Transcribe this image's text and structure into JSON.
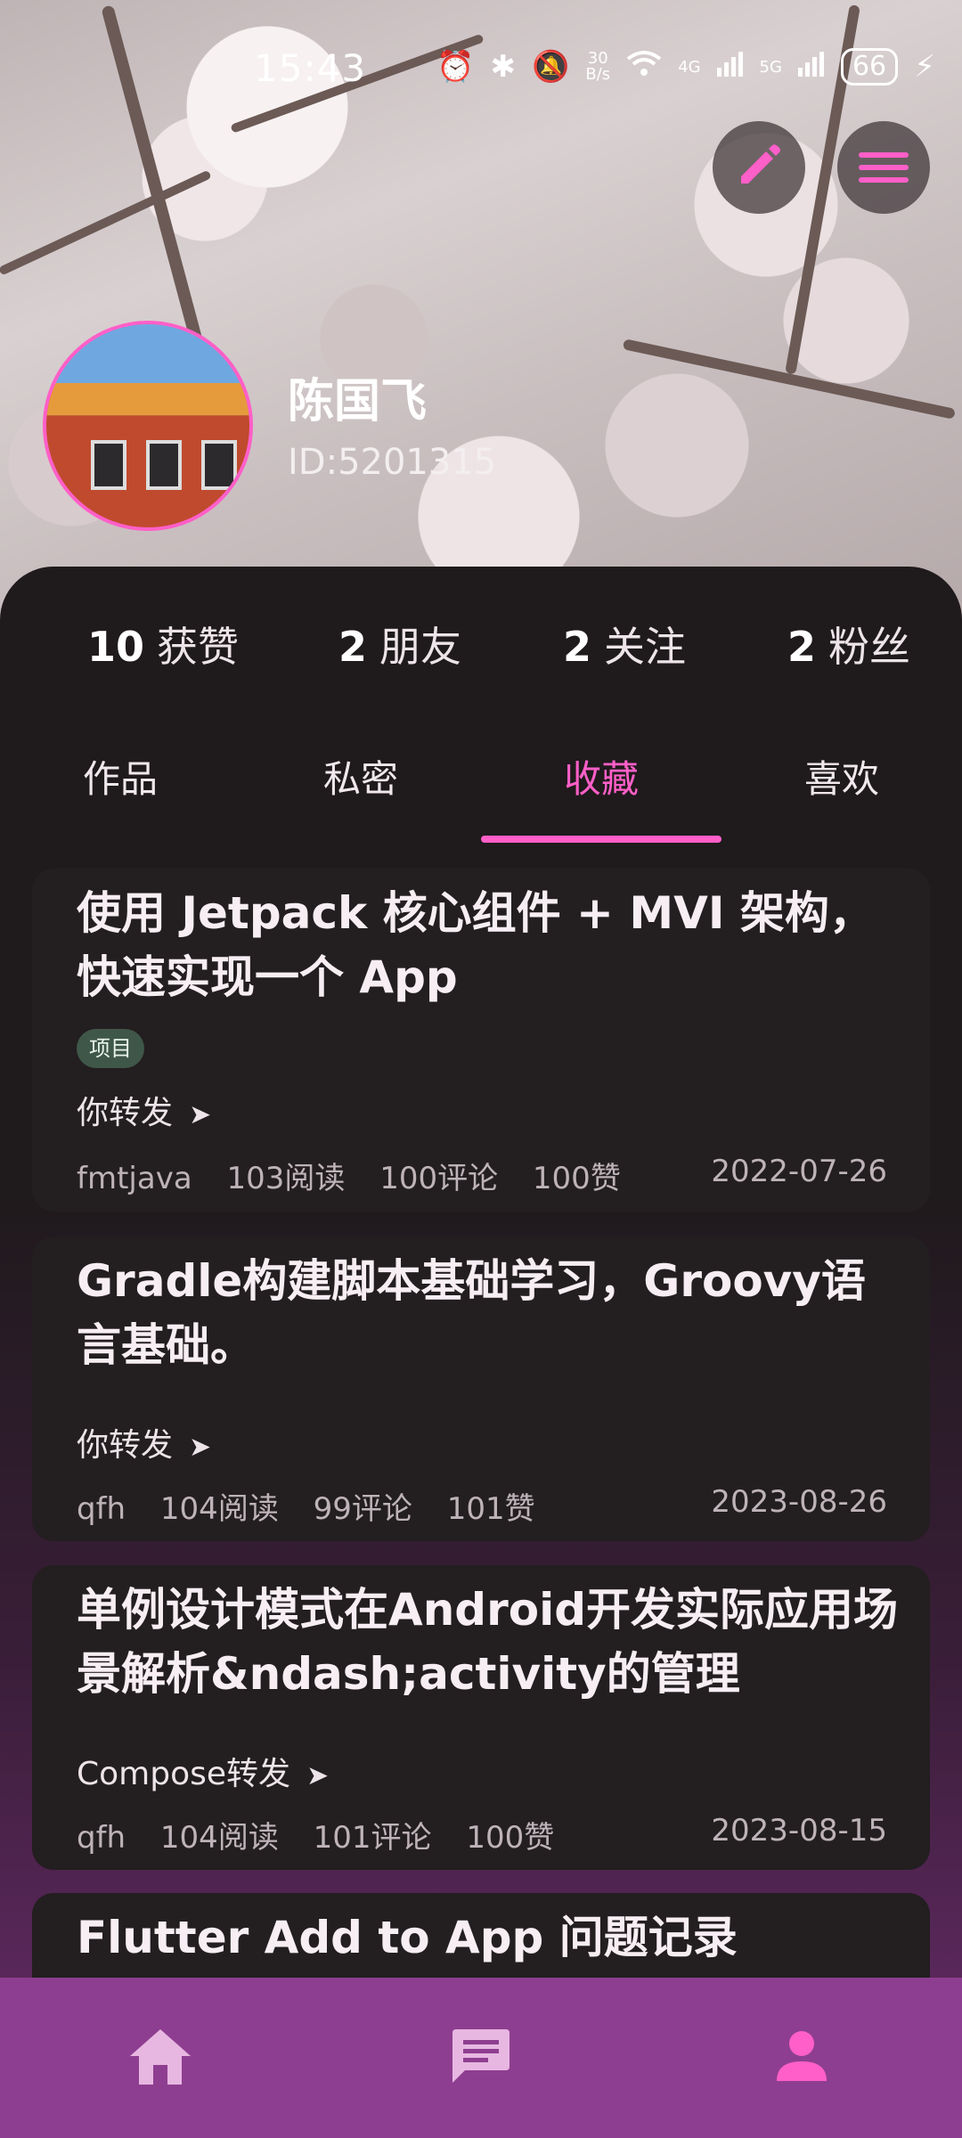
{
  "status_bar": {
    "time": "15:43",
    "net_speed_value": "30",
    "net_speed_unit": "B/s",
    "signal_4g": "4G",
    "signal_5g": "5G",
    "battery": "66"
  },
  "profile": {
    "name": "陈国飞",
    "id": "ID:5201315"
  },
  "stats": [
    {
      "num": "10",
      "label": "获赞"
    },
    {
      "num": "2",
      "label": "朋友"
    },
    {
      "num": "2",
      "label": "关注"
    },
    {
      "num": "2",
      "label": "粉丝"
    }
  ],
  "tabs": [
    {
      "label": "作品"
    },
    {
      "label": "私密"
    },
    {
      "label": "收藏"
    },
    {
      "label": "喜欢"
    }
  ],
  "active_tab": "收藏",
  "posts": [
    {
      "title": "使用 Jetpack 核心组件 + MVI 架构，快速实现一个 App",
      "tag": "项目",
      "share": "你转发",
      "author": "fmtjava",
      "reads": "103阅读",
      "comments": "100评论",
      "likes": "100赞",
      "date": "2022-07-26"
    },
    {
      "title": "Gradle构建脚本基础学习，Groovy语言基础。",
      "share": "你转发",
      "author": "qfh",
      "reads": "104阅读",
      "comments": "99评论",
      "likes": "101赞",
      "date": "2023-08-26"
    },
    {
      "title": "单例设计模式在Android开发实际应用场景解析&ndash;activity的管理",
      "share": "Compose转发",
      "author": "qfh",
      "reads": "104阅读",
      "comments": "101评论",
      "likes": "100赞",
      "date": "2023-08-15"
    },
    {
      "title": "Flutter Add to App 问题记录"
    }
  ],
  "colors": {
    "accent": "#ff5fc8",
    "nav_bg": "#8e3e90",
    "card_bg": "#231e20",
    "tag_bg": "#3f5748"
  },
  "icons": {
    "edit": "pencil-icon",
    "menu": "hamburger-menu-icon",
    "nav_home": "home-icon",
    "nav_message": "message-icon",
    "nav_profile": "person-icon"
  }
}
